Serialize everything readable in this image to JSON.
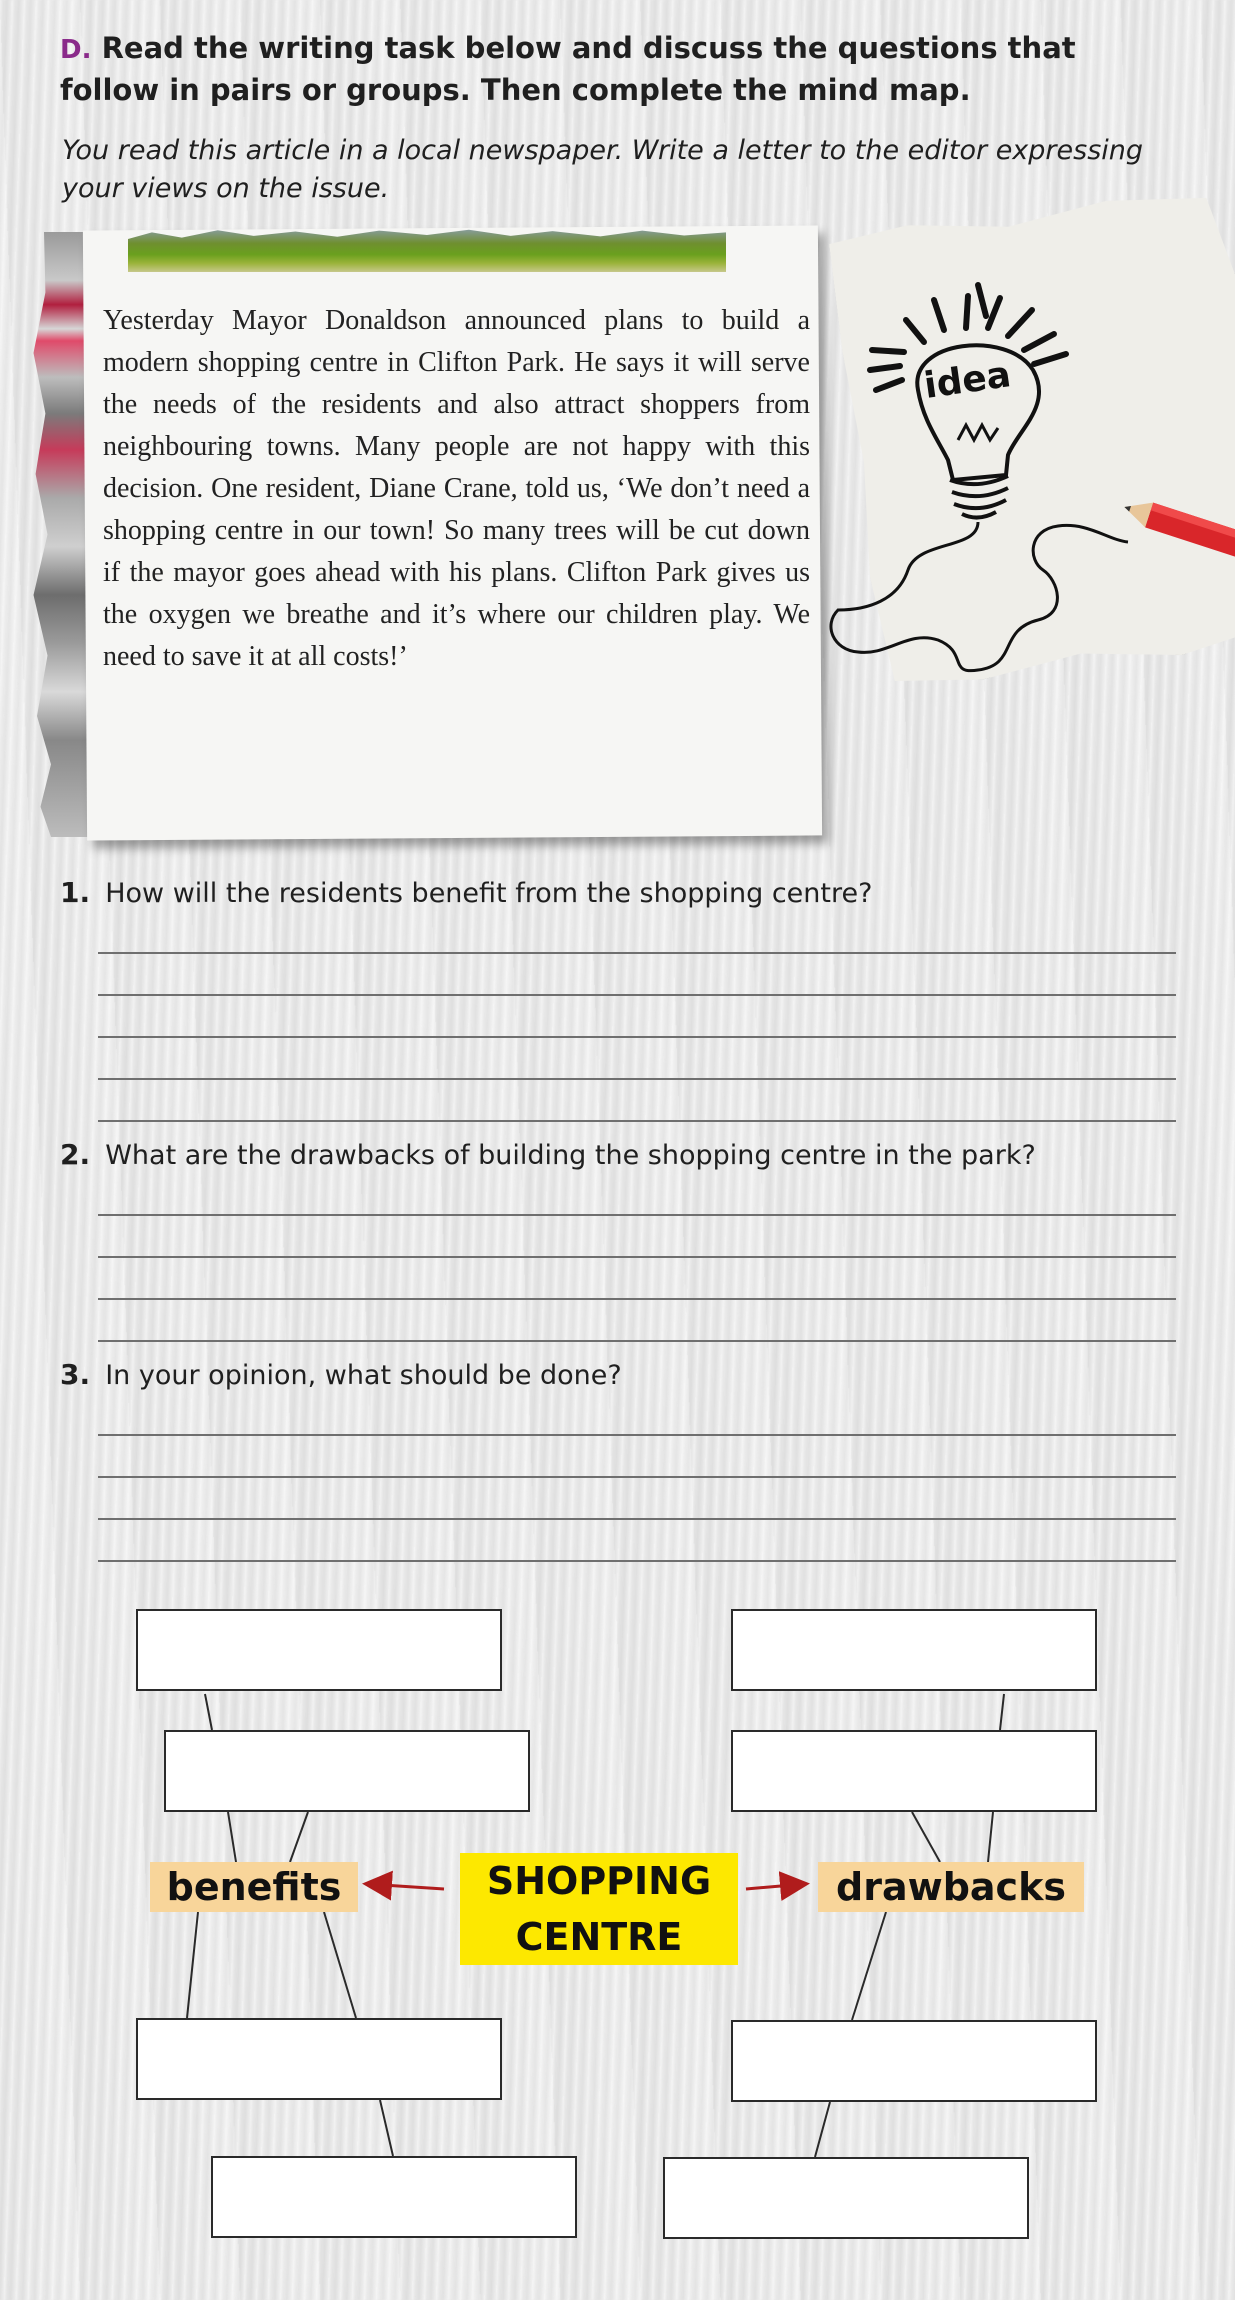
{
  "instructions": {
    "letter": "D.",
    "text": "Read the writing task below and discuss the questions that follow in pairs or groups. Then complete the mind map."
  },
  "task": "You read this article in a local newspaper. Write a letter to the editor expressing your views on the issue.",
  "article": "Yesterday Mayor Donaldson announced plans to build a modern shopping centre in Clifton Park. He says it will serve the needs of the residents and also attract shoppers from neighbouring towns. Many people are not happy with this decision. One resident, Diane Crane, told us, ‘We don’t need a shopping centre in our town! So many trees will be cut down if the mayor goes ahead with his plans. Clifton Park gives us the oxygen we breathe and it’s where our children play. We need to save it at all costs!’",
  "idea_note": {
    "word": "idea"
  },
  "questions": [
    {
      "num": "1.",
      "text": "How will the residents benefit from the shopping centre?"
    },
    {
      "num": "2.",
      "text": "What are the drawbacks of building the shopping centre in the park?"
    },
    {
      "num": "3.",
      "text": "In your opinion, what should be done?"
    }
  ],
  "mind_map": {
    "center_line1": "SHOPPING",
    "center_line2": "CENTRE",
    "left_label": "benefits",
    "right_label": "drawbacks"
  },
  "colors": {
    "letter": "#8a2a8a",
    "center_fill": "#fde800",
    "label_fill": "#f8d59a",
    "arrow": "#b01c1c"
  }
}
